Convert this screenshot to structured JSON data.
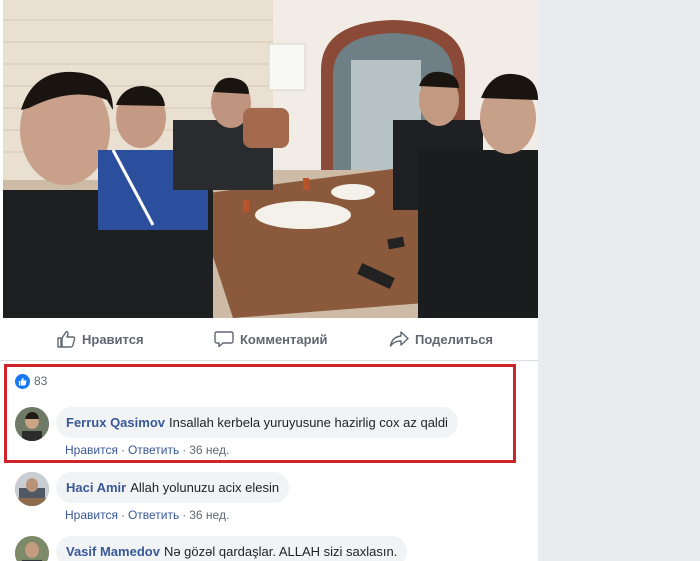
{
  "actions": {
    "like_label": "Нравится",
    "comment_label": "Комментарий",
    "share_label": "Поделиться"
  },
  "reactions": {
    "count": "83"
  },
  "comments": [
    {
      "author": "Ferrux Qasimov",
      "text": "Insallah kerbela yuruyusune hazirlig cox az qaldi",
      "like": "Нравится",
      "reply": "Ответить",
      "time": "36 нед."
    },
    {
      "author": "Haci Amir",
      "text": "Allah yolunuzu acix elesin",
      "like": "Нравится",
      "reply": "Ответить",
      "time": "36 нед."
    },
    {
      "author": "Vasif Mamedov",
      "text": "Nə gözəl qardaşlar. ALLAH sizi saxlasın."
    }
  ],
  "colors": {
    "link": "#385898",
    "muted": "#606770",
    "highlight": "#d0242c",
    "like_blue": "#1877f2"
  }
}
